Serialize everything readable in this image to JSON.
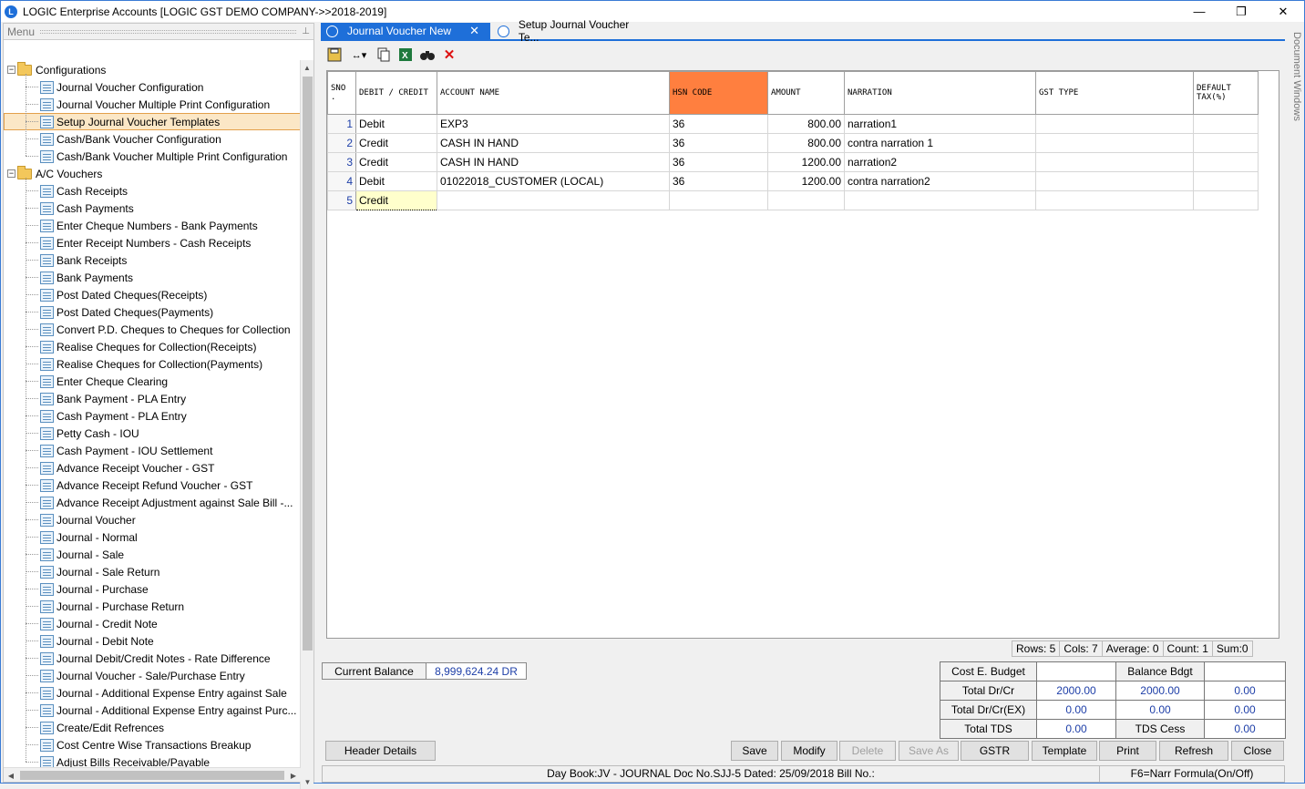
{
  "window": {
    "title": "LOGIC Enterprise Accounts  [LOGIC GST DEMO COMPANY->>2018-2019]",
    "minimize": "—",
    "restore": "❐",
    "close": "✕"
  },
  "menu": {
    "header": "Menu",
    "pin": "📌",
    "groups": [
      {
        "label": "Configurations",
        "expander": "−",
        "items": [
          "Journal Voucher Configuration",
          "Journal Voucher Multiple Print Configuration",
          "Setup Journal Voucher Templates",
          "Cash/Bank Voucher Configuration",
          "Cash/Bank Voucher Multiple Print Configuration"
        ]
      },
      {
        "label": "A/C Vouchers",
        "expander": "−",
        "items": [
          "Cash Receipts",
          "Cash Payments",
          "Enter Cheque Numbers - Bank Payments",
          "Enter Receipt Numbers - Cash Receipts",
          "Bank Receipts",
          "Bank Payments",
          "Post Dated Cheques(Receipts)",
          "Post Dated Cheques(Payments)",
          "Convert P.D. Cheques to Cheques for Collection",
          "Realise Cheques for Collection(Receipts)",
          "Realise Cheques for Collection(Payments)",
          "Enter Cheque Clearing",
          "Bank Payment - PLA Entry",
          "Cash Payment - PLA Entry",
          "Petty Cash - IOU",
          "Cash Payment - IOU Settlement",
          "Advance Receipt Voucher - GST",
          "Advance Receipt Refund Voucher - GST",
          "Advance Receipt Adjustment against Sale Bill -...",
          "Journal Voucher",
          "Journal - Normal",
          "Journal - Sale",
          "Journal - Sale Return",
          "Journal - Purchase",
          "Journal - Purchase Return",
          "Journal - Credit Note",
          "Journal - Debit Note",
          "Journal Debit/Credit Notes - Rate Difference",
          "Journal Voucher - Sale/Purchase Entry",
          "Journal - Additional Expense Entry against Sale",
          "Journal - Additional Expense Entry against Purc...",
          "Create/Edit Refrences",
          "Cost Centre Wise Transactions Breakup",
          "Adjust Bills Receivable/Payable"
        ]
      }
    ],
    "selected": "Setup Journal Voucher Templates",
    "scroll_up": "▲",
    "scroll_down": "▼",
    "scroll_left": "◀",
    "scroll_right": "▶"
  },
  "tabs": [
    {
      "label": "Journal Voucher New",
      "close": "✕",
      "active": true
    },
    {
      "label": "Setup Journal Voucher Te...",
      "active": false
    }
  ],
  "doc_windows_label": "Document Windows",
  "toolbar": {
    "save_icon": "💾",
    "resize_icon": "↔▾",
    "copy_icon": "📋",
    "excel_icon": "X",
    "find_icon": "🔭",
    "delete_icon": "✕"
  },
  "grid": {
    "columns": [
      "SNO .",
      "DEBIT / CREDIT",
      "ACCOUNT NAME",
      "HSN CODE",
      "AMOUNT",
      "NARRATION",
      "GST TYPE",
      "DEFAULT TAX(%)"
    ],
    "rows": [
      {
        "sno": "1",
        "dc": "Debit",
        "account": "EXP3",
        "hsn": "36",
        "amount": "800.00",
        "narration": "narration1",
        "gst": "",
        "tax": ""
      },
      {
        "sno": "2",
        "dc": "Credit",
        "account": "CASH IN HAND",
        "hsn": "36",
        "amount": "800.00",
        "narration": "contra narration 1",
        "gst": "",
        "tax": ""
      },
      {
        "sno": "3",
        "dc": "Credit",
        "account": "CASH IN HAND",
        "hsn": "36",
        "amount": "1200.00",
        "narration": "narration2",
        "gst": "",
        "tax": ""
      },
      {
        "sno": "4",
        "dc": "Debit",
        "account": "01022018_CUSTOMER (LOCAL)",
        "hsn": "36",
        "amount": "1200.00",
        "narration": "contra narration2",
        "gst": "",
        "tax": ""
      },
      {
        "sno": "5",
        "dc": "Credit",
        "account": "",
        "hsn": "",
        "amount": "",
        "narration": "",
        "gst": "",
        "tax": ""
      }
    ],
    "hsn_color": "#ff7f3f"
  },
  "stats": {
    "rows": "Rows: 5",
    "cols": "Cols: 7",
    "average": "Average: 0",
    "count": "Count: 1",
    "sum": "Sum:0"
  },
  "balance": {
    "label": "Current Balance",
    "value": "8,999,624.24 DR"
  },
  "budget": {
    "cost_label": "Cost E. Budget",
    "balance_label": "Balance Bdgt",
    "total_drcr_label": "Total Dr/Cr",
    "total_drcr_a": "2000.00",
    "total_drcr_b": "2000.00",
    "total_drcr_c": "0.00",
    "total_drcr_ex_label": "Total Dr/Cr(EX)",
    "total_drcr_ex_a": "0.00",
    "total_drcr_ex_b": "0.00",
    "total_drcr_ex_c": "0.00",
    "total_tds_label": "Total TDS",
    "total_tds_a": "0.00",
    "tds_cess_label": "TDS Cess",
    "tds_cess_value": "0.00"
  },
  "buttons": {
    "header_details": "Header Details",
    "save": "Save",
    "modify": "Modify",
    "delete": "Delete",
    "save_as": "Save As",
    "gstr": "GSTR",
    "template": "Template",
    "print": "Print",
    "refresh": "Refresh",
    "close": "Close"
  },
  "statusbar": {
    "main": "Day Book:JV - JOURNAL Doc No.SJJ-5 Dated: 25/09/2018 Bill No.:",
    "right": "F6=Narr Formula(On/Off)"
  },
  "colors": {
    "accent": "#1e6fd9",
    "selected_bg": "#fbe7c6",
    "value_blue": "#1e3fa8"
  }
}
